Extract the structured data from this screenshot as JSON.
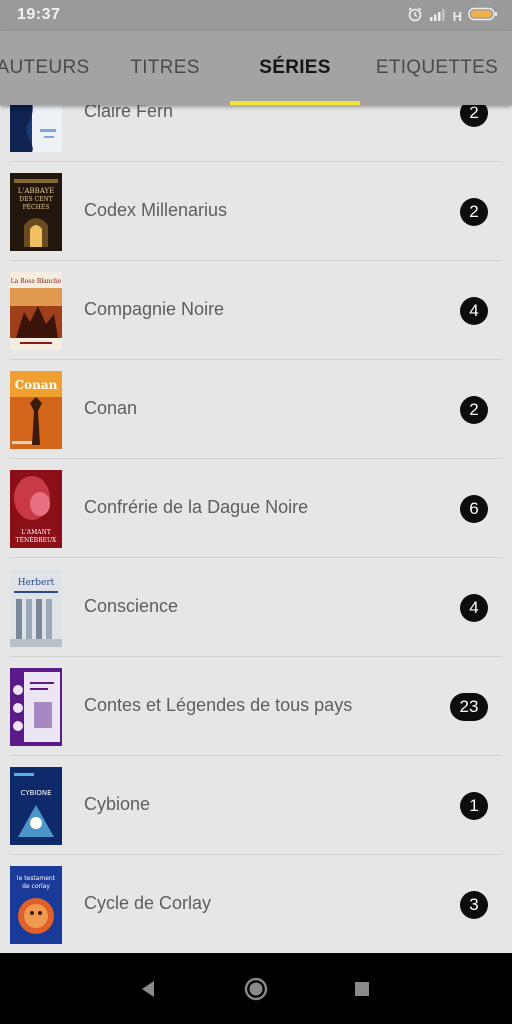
{
  "status_bar": {
    "time": "19:37",
    "network_label": "H",
    "icons": [
      "alarm-icon",
      "signal-icon",
      "battery-icon"
    ]
  },
  "tabs": [
    {
      "label": "AUTEURS",
      "active": false
    },
    {
      "label": "TITRES",
      "active": false
    },
    {
      "label": "SÉRIES",
      "active": true
    },
    {
      "label": "ETIQUETTES",
      "active": false
    }
  ],
  "accent_color": "#f5e33a",
  "series": [
    {
      "name": "Claire Fern",
      "count": "2",
      "cover_colors": [
        "#1b3a7a",
        "#e9eef5"
      ]
    },
    {
      "name": "Codex Millenarius",
      "count": "2",
      "cover_colors": [
        "#2b1d12",
        "#c9a14a"
      ],
      "cover_text": "L'ABBAYE DES CENT PÉCHÉS"
    },
    {
      "name": "Compagnie Noire",
      "count": "4",
      "cover_colors": [
        "#7a2a10",
        "#e0b070"
      ],
      "cover_text": "La Rose Blanche"
    },
    {
      "name": "Conan",
      "count": "2",
      "cover_colors": [
        "#c85a16",
        "#f0a030"
      ],
      "cover_text": "Conan"
    },
    {
      "name": "Confrérie de la Dague Noire",
      "count": "6",
      "cover_colors": [
        "#8a0f16",
        "#d04050"
      ],
      "cover_text": "L'AMANT TÉNÉBREUX"
    },
    {
      "name": "Conscience",
      "count": "4",
      "cover_colors": [
        "#d8dde2",
        "#3a5a8a"
      ],
      "cover_text": "Herbert"
    },
    {
      "name": "Contes et Légendes de tous pays",
      "count": "23",
      "cover_colors": [
        "#5a1a8a",
        "#e6e0f0"
      ]
    },
    {
      "name": "Cybione",
      "count": "1",
      "cover_colors": [
        "#0f2a6a",
        "#5ab0e0"
      ],
      "cover_text": "CYBIONE"
    },
    {
      "name": "Cycle de Corlay",
      "count": "3",
      "cover_colors": [
        "#1a3a9a",
        "#e04a20"
      ],
      "cover_text": "le testament de corlay"
    }
  ],
  "nav": {
    "back": "back-icon",
    "home": "home-icon",
    "recent": "recent-apps-icon"
  }
}
